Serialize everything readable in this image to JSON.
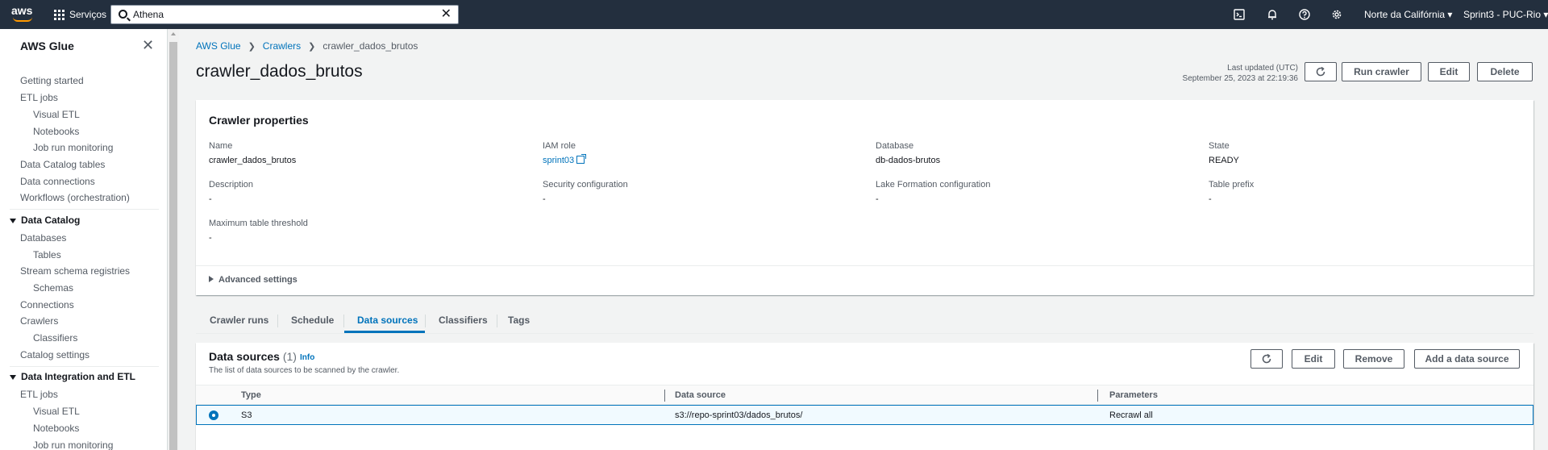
{
  "topnav": {
    "logo": "aws",
    "services_label": "Serviços",
    "search_value": "Athena",
    "region": "Norte da Califórnia",
    "account": "Sprint3 - PUC-Rio",
    "icons": [
      "cloudshell-icon",
      "bell-icon",
      "help-icon",
      "gear-icon"
    ]
  },
  "sidebar": {
    "title": "AWS Glue",
    "items": [
      "Getting started",
      "ETL jobs",
      "Visual ETL",
      "Notebooks",
      "Job run monitoring",
      "Data Catalog tables",
      "Data connections",
      "Workflows (orchestration)"
    ],
    "section_catalog": "Data Catalog",
    "catalog_items": [
      "Databases",
      "Tables",
      "Stream schema registries",
      "Schemas",
      "Connections",
      "Crawlers",
      "Classifiers",
      "Catalog settings"
    ],
    "section_etl": "Data Integration and ETL",
    "etl_items": [
      "ETL jobs",
      "Visual ETL",
      "Notebooks",
      "Job run monitoring"
    ]
  },
  "breadcrumb": [
    "AWS Glue",
    "Crawlers",
    "crawler_dados_brutos"
  ],
  "page": {
    "title": "crawler_dados_brutos",
    "last_updated_label": "Last updated (UTC)",
    "last_updated_value": "September 25, 2023 at 22:19:36",
    "run_label": "Run crawler",
    "edit_label": "Edit",
    "delete_label": "Delete"
  },
  "properties": {
    "heading": "Crawler properties",
    "name_label": "Name",
    "name_value": "crawler_dados_brutos",
    "iam_label": "IAM role",
    "iam_value": "sprint03",
    "db_label": "Database",
    "db_value": "db-dados-brutos",
    "state_label": "State",
    "state_value": "READY",
    "desc_label": "Description",
    "desc_value": "-",
    "sec_label": "Security configuration",
    "sec_value": "-",
    "lf_label": "Lake Formation configuration",
    "lf_value": "-",
    "prefix_label": "Table prefix",
    "prefix_value": "-",
    "max_label": "Maximum table threshold",
    "max_value": "-",
    "advanced": "Advanced settings"
  },
  "tabs": [
    "Crawler runs",
    "Schedule",
    "Data sources",
    "Classifiers",
    "Tags"
  ],
  "data_sources": {
    "title": "Data sources",
    "count": "(1)",
    "info": "Info",
    "description": "The list of data sources to be scanned by the crawler.",
    "edit_label": "Edit",
    "remove_label": "Remove",
    "add_label": "Add a data source",
    "columns": [
      "Type",
      "Data source",
      "Parameters"
    ],
    "rows": [
      {
        "type": "S3",
        "source": "s3://repo-sprint03/dados_brutos/",
        "params": "Recrawl all"
      }
    ]
  }
}
